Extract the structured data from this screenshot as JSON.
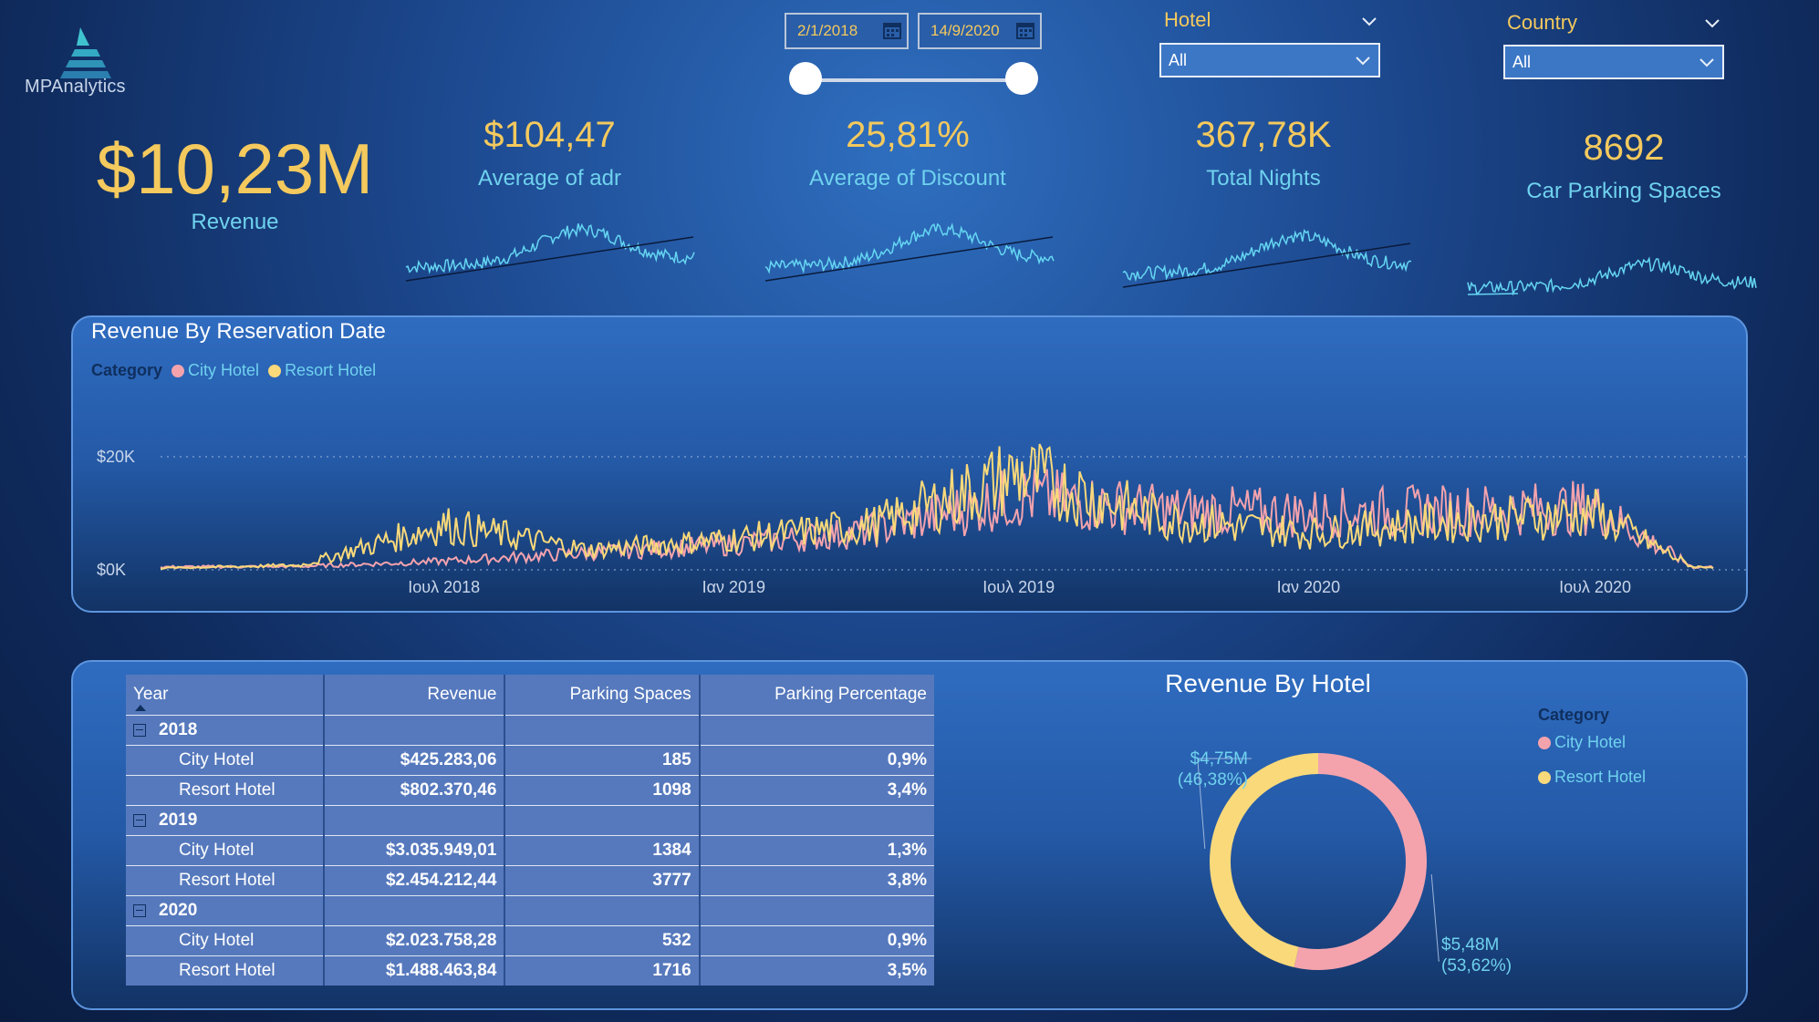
{
  "brand": {
    "name": "MPAnalytics"
  },
  "date_slicer": {
    "start": "2/1/2018",
    "end": "14/9/2020"
  },
  "slicers": [
    {
      "title": "Hotel",
      "value": "All"
    },
    {
      "title": "Country",
      "value": "All"
    }
  ],
  "kpis": {
    "revenue": {
      "value": "$10,23M",
      "label": "Revenue"
    },
    "adr": {
      "value": "$104,47",
      "label": "Average of adr"
    },
    "discount": {
      "value": "25,81%",
      "label": "Average of Discount"
    },
    "nights": {
      "value": "367,78K",
      "label": "Total Nights"
    },
    "parking": {
      "value": "8692",
      "label": "Car Parking Spaces"
    }
  },
  "colors": {
    "city": "#f4a3ad",
    "resort": "#f9d97a",
    "accent": "#f4c95d",
    "label": "#6fd2ee",
    "spark": "#65d6f2"
  },
  "line_panel": {
    "title": "Revenue By Reservation Date",
    "legend_title": "Category",
    "legend": [
      "City Hotel",
      "Resort Hotel"
    ]
  },
  "table": {
    "headers": [
      "Year",
      "Revenue",
      "Parking Spaces",
      "Parking Percentage"
    ],
    "groups": [
      {
        "year": "2018",
        "rows": [
          {
            "name": "City Hotel",
            "revenue": "$425.283,06",
            "parking": "185",
            "pct": "0,9%"
          },
          {
            "name": "Resort Hotel",
            "revenue": "$802.370,46",
            "parking": "1098",
            "pct": "3,4%"
          }
        ]
      },
      {
        "year": "2019",
        "rows": [
          {
            "name": "City Hotel",
            "revenue": "$3.035.949,01",
            "parking": "1384",
            "pct": "1,3%"
          },
          {
            "name": "Resort Hotel",
            "revenue": "$2.454.212,44",
            "parking": "3777",
            "pct": "3,8%"
          }
        ]
      },
      {
        "year": "2020",
        "rows": [
          {
            "name": "City Hotel",
            "revenue": "$2.023.758,28",
            "parking": "532",
            "pct": "0,9%"
          },
          {
            "name": "Resort Hotel",
            "revenue": "$1.488.463,84",
            "parking": "1716",
            "pct": "3,5%"
          }
        ]
      }
    ]
  },
  "donut_panel": {
    "title": "Revenue By Hotel",
    "legend_title": "Category",
    "legend": [
      "City Hotel",
      "Resort Hotel"
    ]
  },
  "chart_data": [
    {
      "type": "line",
      "title": "Revenue By Reservation Date",
      "yticks": [
        "$0K",
        "$20K"
      ],
      "ylim": [
        0,
        25000
      ],
      "xticks": [
        "Ιουλ 2018",
        "Ιαν 2019",
        "Ιουλ 2019",
        "Ιαν 2020",
        "Ιουλ 2020"
      ],
      "xlim": [
        "2018-01-02",
        "2020-09-14"
      ],
      "legend_placement": "top-left",
      "series": [
        {
          "name": "City Hotel",
          "x": [
            "2018-01",
            "2018-04",
            "2018-07",
            "2018-10",
            "2019-01",
            "2019-04",
            "2019-07",
            "2019-10",
            "2020-01",
            "2020-04",
            "2020-07",
            "2020-09"
          ],
          "y": [
            500,
            600,
            1500,
            3000,
            4500,
            7000,
            13000,
            10500,
            10000,
            10500,
            11000,
            500
          ]
        },
        {
          "name": "Resort Hotel",
          "x": [
            "2018-01",
            "2018-04",
            "2018-07",
            "2018-10",
            "2019-01",
            "2019-04",
            "2019-07",
            "2019-10",
            "2020-01",
            "2020-04",
            "2020-07",
            "2020-09"
          ],
          "y": [
            300,
            800,
            8000,
            3500,
            5500,
            8000,
            17000,
            9000,
            6500,
            8500,
            10000,
            500
          ]
        }
      ]
    },
    {
      "type": "pie",
      "title": "Revenue By Hotel",
      "categories": [
        "City Hotel",
        "Resort Hotel"
      ],
      "values": [
        5.48,
        4.75
      ],
      "labels": [
        "$5,48M (53,62%)",
        "$4,75M (46,38%)"
      ],
      "label_parts": [
        [
          "$5,48M",
          "(53,62%)"
        ],
        [
          "$4,75M",
          "(46,38%)"
        ]
      ]
    }
  ]
}
